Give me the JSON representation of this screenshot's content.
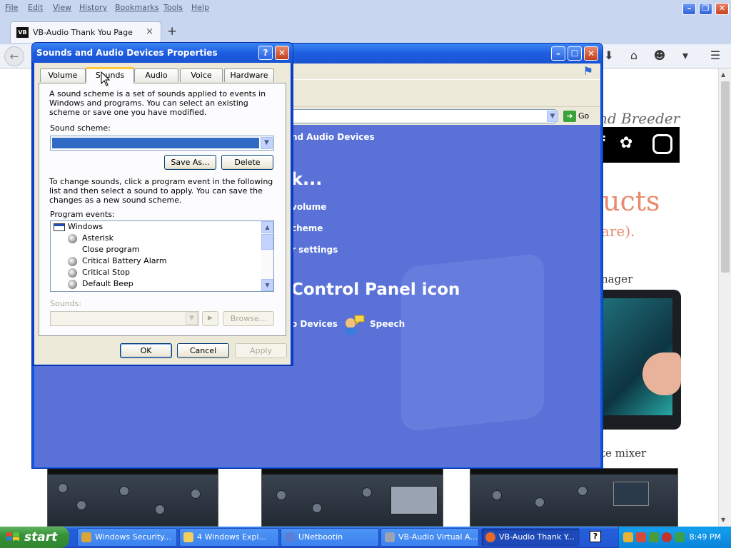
{
  "firefox": {
    "menu": [
      "File",
      "Edit",
      "View",
      "History",
      "Bookmarks",
      "Tools",
      "Help"
    ],
    "tab": {
      "favicon": "VB",
      "title": "VB-Audio Thank You Page",
      "close": "×"
    },
    "new_tab": "+",
    "toolbar_icons": [
      "download-icon",
      "home-icon",
      "smiley-icon",
      "pocket-icon",
      "menu-icon"
    ]
  },
  "webpage": {
    "script_heading": "nd Breeder",
    "heading_fragment": "ucts",
    "subheading_fragment": "are).",
    "label_manager": "nager",
    "label_mixer": "te mixer"
  },
  "control_panel": {
    "go_label": "Go",
    "breadcrumb": "nd Audio Devices",
    "pick_task": "k...",
    "tasks": [
      "volume",
      "cheme",
      "r settings"
    ],
    "or_pick": "Control Panel icon",
    "icons": [
      "o Devices",
      "Speech"
    ]
  },
  "dialog": {
    "title": "Sounds and Audio Devices Properties",
    "tabs": [
      "Volume",
      "Sounds",
      "Audio",
      "Voice",
      "Hardware"
    ],
    "active_tab": "Sounds",
    "intro": "A sound scheme is a set of sounds applied to events in Windows and programs. You can select an existing scheme or save one you have modified.",
    "scheme_label": "Sound scheme:",
    "scheme_value": "",
    "save_as": "Save As...",
    "delete": "Delete",
    "change_text": "To change sounds, click a program event in the following list and then select a sound to apply. You can save the changes as a new sound scheme.",
    "events_label": "Program events:",
    "events": [
      {
        "name": "Windows",
        "type": "group"
      },
      {
        "name": "Asterisk",
        "type": "sound"
      },
      {
        "name": "Close program",
        "type": "none"
      },
      {
        "name": "Critical Battery Alarm",
        "type": "sound"
      },
      {
        "name": "Critical Stop",
        "type": "sound"
      },
      {
        "name": "Default Beep",
        "type": "sound"
      }
    ],
    "sounds_label": "Sounds:",
    "browse": "Browse...",
    "ok": "OK",
    "cancel": "Cancel",
    "apply": "Apply"
  },
  "taskbar": {
    "start": "start",
    "tasks": [
      {
        "label": "Windows Security...",
        "icon_color": "#d9a53b",
        "active": false
      },
      {
        "label": "4 Windows Expl...",
        "icon_color": "#f2cf5b",
        "active": false
      },
      {
        "label": "UNetbootin",
        "icon_color": "#5b7fd6",
        "active": false
      },
      {
        "label": "VB-Audio Virtual A...",
        "icon_color": "#9aa4b3",
        "active": false
      },
      {
        "label": "VB-Audio Thank Y...",
        "icon_color": "#e56a2a",
        "active": true
      }
    ],
    "help_icon": "?",
    "clock": "8:49 PM"
  },
  "colors": {
    "xp_blue": "#0b56e4",
    "cp_body": "#5a72d8",
    "start_green": "#379337",
    "web_accent": "#e98a6c"
  }
}
